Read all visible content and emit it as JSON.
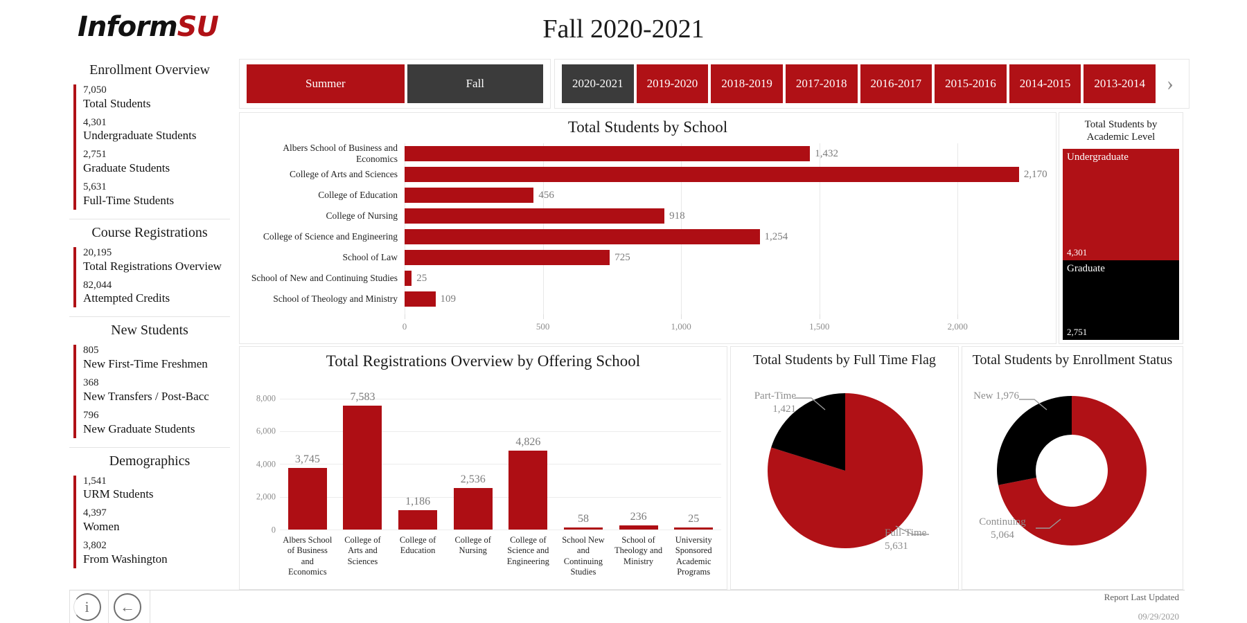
{
  "brand": {
    "name_black": "Inform",
    "name_red": "SU",
    "accent": "#B01116"
  },
  "header": {
    "title": "Fall 2020-2021"
  },
  "sidebar": {
    "groups": [
      {
        "title": "Enrollment Overview",
        "items": [
          {
            "value": "7,050",
            "label": "Total Students"
          },
          {
            "value": "4,301",
            "label": "Undergraduate Students"
          },
          {
            "value": "2,751",
            "label": "Graduate Students"
          },
          {
            "value": "5,631",
            "label": "Full-Time Students"
          }
        ]
      },
      {
        "title": "Course Registrations",
        "items": [
          {
            "value": "20,195",
            "label": "Total Registrations Overview"
          },
          {
            "value": "82,044",
            "label": "Attempted Credits"
          }
        ]
      },
      {
        "title": "New Students",
        "items": [
          {
            "value": "805",
            "label": "New First-Time Freshmen"
          },
          {
            "value": "368",
            "label": "New Transfers / Post-Bacc"
          },
          {
            "value": "796",
            "label": "New Graduate Students"
          }
        ]
      },
      {
        "title": "Demographics",
        "items": [
          {
            "value": "1,541",
            "label": "URM Students"
          },
          {
            "value": "4,397",
            "label": "Women"
          },
          {
            "value": "3,802",
            "label": "From Washington"
          }
        ]
      }
    ]
  },
  "filters": {
    "terms": [
      {
        "label": "Summer",
        "selected": false
      },
      {
        "label": "Fall",
        "selected": true
      }
    ],
    "years": [
      {
        "label": "2020-2021",
        "selected": true
      },
      {
        "label": "2019-2020",
        "selected": false
      },
      {
        "label": "2018-2019",
        "selected": false
      },
      {
        "label": "2017-2018",
        "selected": false
      },
      {
        "label": "2016-2017",
        "selected": false
      },
      {
        "label": "2015-2016",
        "selected": false
      },
      {
        "label": "2014-2015",
        "selected": false
      },
      {
        "label": "2013-2014",
        "selected": false
      }
    ],
    "next_arrow": "›"
  },
  "footer": {
    "info_icon": "i",
    "back_icon": "←",
    "updated_label": "Report Last Updated",
    "updated_date": "09/29/2020"
  },
  "chart_data": [
    {
      "id": "students_by_school",
      "type": "bar",
      "orientation": "horizontal",
      "title": "Total Students by School",
      "categories": [
        "Albers School of Business and Economics",
        "College of Arts and Sciences",
        "College of Education",
        "College of Nursing",
        "College of Science and Engineering",
        "School of Law",
        "School of New and Continuing Studies",
        "School of Theology and Ministry"
      ],
      "values": [
        1432,
        2170,
        456,
        918,
        1254,
        725,
        25,
        109
      ],
      "labels": [
        "1,432",
        "2,170",
        "456",
        "918",
        "1,254",
        "725",
        "25",
        "109"
      ],
      "xlabel": "",
      "ylabel": "",
      "xlim": [
        0,
        2300
      ],
      "xticks": [
        0,
        500,
        1000,
        1500,
        2000
      ],
      "xtick_labels": [
        "0",
        "500",
        "1,000",
        "1,500",
        "2,000"
      ],
      "grid": true,
      "bar_color": "#AE0E14"
    },
    {
      "id": "students_by_academic_level",
      "type": "treemap",
      "title": "Total Students by\nAcademic Level",
      "title_line1": "Total Students by",
      "title_line2": "Academic Level",
      "categories": [
        "Undergraduate",
        "Graduate"
      ],
      "values": [
        4301,
        2751
      ],
      "labels": [
        "4,301",
        "2,751"
      ],
      "colors": [
        "#B01116",
        "#000000"
      ]
    },
    {
      "id": "registrations_by_offering_school",
      "type": "bar",
      "orientation": "vertical",
      "title": "Total Registrations Overview by Offering School",
      "categories": [
        "Albers School of Business and Economics",
        "College of Arts and Sciences",
        "College of Education",
        "College of Nursing",
        "College of Science and Engineering",
        "School New and Continuing Studies",
        "School of Theology and Ministry",
        "University Sponsored Academic Programs"
      ],
      "values": [
        3745,
        7583,
        1186,
        2536,
        4826,
        58,
        236,
        25
      ],
      "labels": [
        "3,745",
        "7,583",
        "1,186",
        "2,536",
        "4,826",
        "58",
        "236",
        "25"
      ],
      "ylim": [
        0,
        8800
      ],
      "yticks": [
        0,
        2000,
        4000,
        6000,
        8000
      ],
      "ytick_labels": [
        "0",
        "2,000",
        "4,000",
        "6,000",
        "8,000"
      ],
      "grid": true,
      "bar_color": "#AE0E14"
    },
    {
      "id": "students_by_full_time_flag",
      "type": "pie",
      "title": "Total Students by Full Time Flag",
      "categories": [
        "Full-Time",
        "Part-Time"
      ],
      "values": [
        5631,
        1421
      ],
      "labels": [
        "5,631",
        "1,421"
      ],
      "colors": [
        "#B01116",
        "#000000"
      ],
      "annotations": [
        {
          "name": "Part-Time",
          "value": "1,421",
          "position": "upper-left"
        },
        {
          "name": "Full-Time",
          "value": "5,631",
          "position": "lower-right"
        }
      ]
    },
    {
      "id": "students_by_enrollment_status",
      "type": "pie",
      "variant": "donut",
      "title": "Total Students by Enrollment Status",
      "categories": [
        "Continuing",
        "New"
      ],
      "values": [
        5064,
        1976
      ],
      "labels": [
        "5,064",
        "1,976"
      ],
      "colors": [
        "#B01116",
        "#000000"
      ],
      "annotations": [
        {
          "name": "New",
          "value": "1,976",
          "text": "New 1,976",
          "position": "upper-left"
        },
        {
          "name": "Continuing",
          "value": "5,064",
          "position": "lower-left"
        }
      ]
    }
  ]
}
